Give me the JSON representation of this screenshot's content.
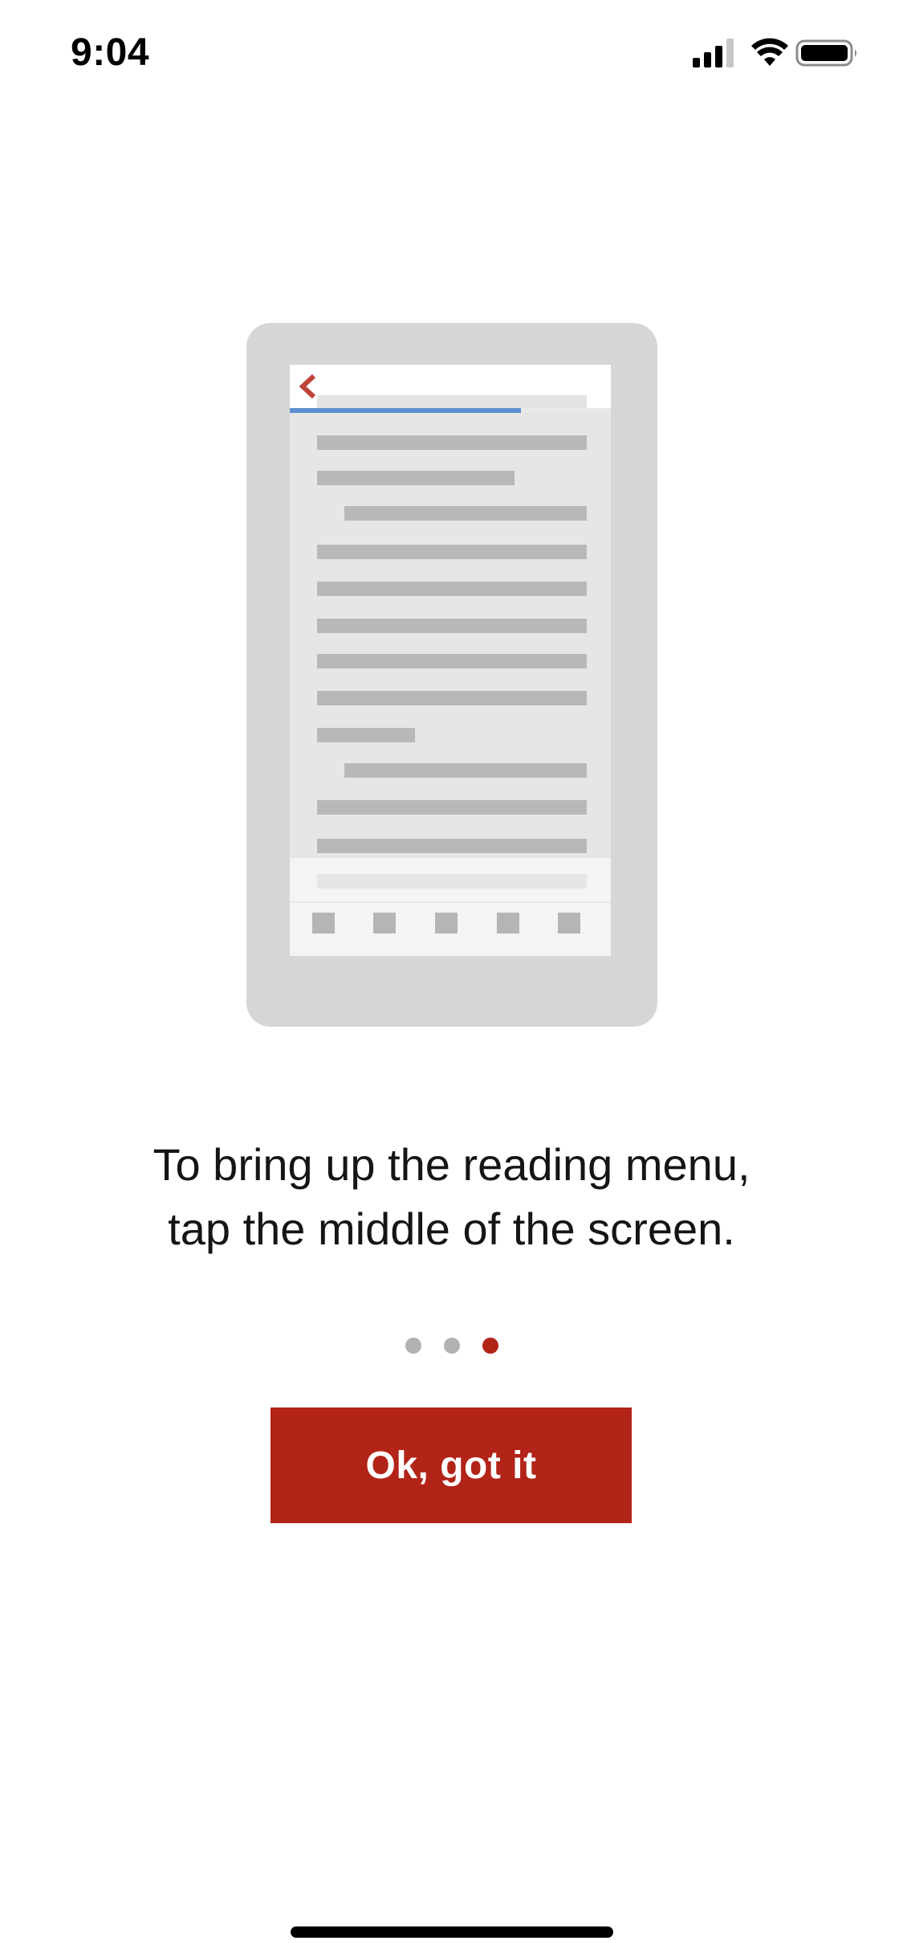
{
  "status_bar": {
    "time": "9:04",
    "icons": [
      "signal-icon",
      "wifi-icon",
      "battery-icon"
    ]
  },
  "illustration": {
    "description_icons": [
      "phone-frame",
      "back-chevron-icon"
    ],
    "progress": 0.72,
    "colors": {
      "frame": "#d6d6d6",
      "screen": "#e6e6e6",
      "text_line": "#b8b8b8",
      "progress": "#5b8fcf",
      "back_chevron": "#c0433a"
    }
  },
  "onboarding": {
    "message_line1": "To bring up the reading menu,",
    "message_line2": "tap the middle of the screen.",
    "page_count": 3,
    "active_page": 3
  },
  "actions": {
    "confirm_label": "Ok, got it"
  },
  "colors": {
    "accent": "#b22318",
    "dot_inactive": "#b2b2b2",
    "background": "#ffffff"
  }
}
